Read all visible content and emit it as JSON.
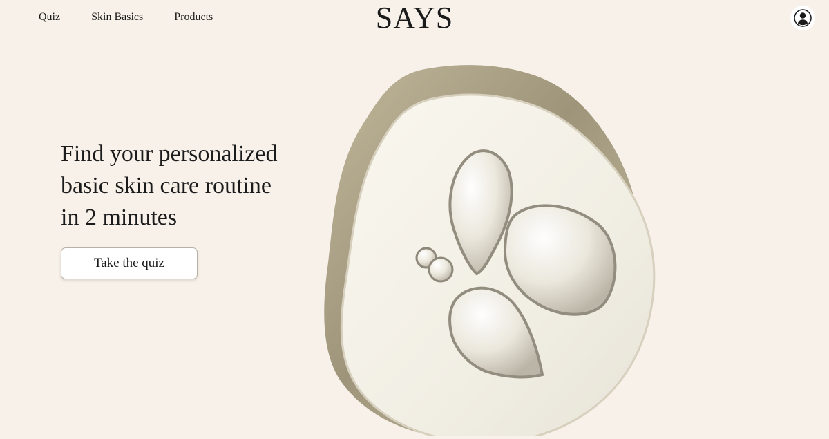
{
  "nav": {
    "links": [
      "Quiz",
      "Skin Basics",
      "Products"
    ],
    "brand": "SAYS"
  },
  "hero": {
    "headline_lines": [
      "Find your personalized",
      "basic skin care routine",
      "in 2 minutes"
    ],
    "cta_label": "Take the quiz"
  },
  "icons": {
    "account": "user-avatar-icon"
  },
  "colors": {
    "background": "#f7f1e9",
    "text": "#1b1b1b",
    "button_bg": "#ffffff",
    "button_border": "#b7b1a8"
  }
}
